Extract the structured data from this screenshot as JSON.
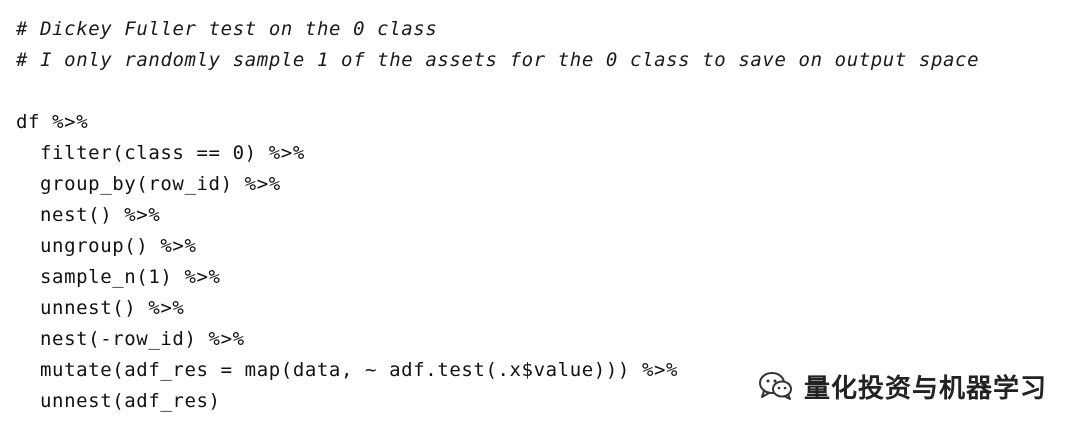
{
  "code": {
    "lines": [
      "# Dickey Fuller test on the 0 class",
      "# I only randomly sample 1 of the assets for the 0 class to save on output space",
      "",
      "df %>%",
      "filter(class == 0) %>%",
      "group_by(row_id) %>%",
      "nest() %>%",
      "ungroup() %>%",
      "sample_n(1) %>%",
      "unnest() %>%",
      "nest(-row_id) %>%",
      "mutate(adf_res = map(data, ~ adf.test(.x$value))) %>%",
      "unnest(adf_res)"
    ]
  },
  "watermark": {
    "text": "量化投资与机器学习",
    "icon": "wechat-icon"
  }
}
